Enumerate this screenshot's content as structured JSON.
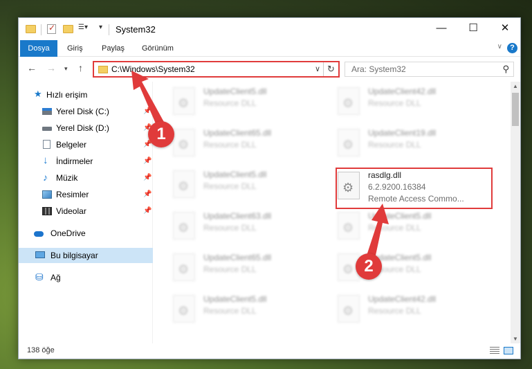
{
  "window": {
    "title": "System32"
  },
  "ribbon": {
    "tabs": [
      "Dosya",
      "Giriş",
      "Paylaş",
      "Görünüm"
    ]
  },
  "address": {
    "path": "C:\\Windows\\System32"
  },
  "search": {
    "placeholder": "Ara: System32"
  },
  "sidebar": {
    "items": [
      {
        "label": "Hızlı erişim"
      },
      {
        "label": "Yerel Disk (C:)"
      },
      {
        "label": "Yerel Disk (D:)"
      },
      {
        "label": "Belgeler"
      },
      {
        "label": "İndirmeler"
      },
      {
        "label": "Müzik"
      },
      {
        "label": "Resimler"
      },
      {
        "label": "Videolar"
      },
      {
        "label": "OneDrive"
      },
      {
        "label": "Bu bilgisayar"
      },
      {
        "label": "Ağ"
      }
    ]
  },
  "files": {
    "left": [
      {
        "name": "UpdateClient5.dll",
        "type": "Resource DLL"
      },
      {
        "name": "UpdateClient65.dll",
        "type": "Resource DLL"
      },
      {
        "name": "UpdateClient5.dll",
        "type": "Resource DLL"
      },
      {
        "name": "UpdateClient63.dll",
        "type": "Resource DLL"
      },
      {
        "name": "UpdateClient65.dll",
        "type": "Resource DLL"
      },
      {
        "name": "UpdateClient5.dll",
        "type": "Resource DLL"
      }
    ],
    "right": [
      {
        "name": "UpdateClient42.dll",
        "type": "Resource DLL"
      },
      {
        "name": "UpdateClient19.dll",
        "type": "Resource DLL"
      },
      {
        "name": "UpdateClient5.dll",
        "type": "Resource DLL"
      },
      {
        "name": "UpdateClient5.dll",
        "type": "Resource DLL"
      },
      {
        "name": "UpdateClient42.dll",
        "type": "Resource DLL"
      }
    ],
    "highlighted": {
      "name": "rasdlg.dll",
      "version": "6.2.9200.16384",
      "description": "Remote Access Commo..."
    }
  },
  "status": {
    "count": "138 öğe"
  },
  "callouts": {
    "one": "1",
    "two": "2"
  },
  "colors": {
    "accent": "#1979ca",
    "annotation": "#e03b3b"
  }
}
